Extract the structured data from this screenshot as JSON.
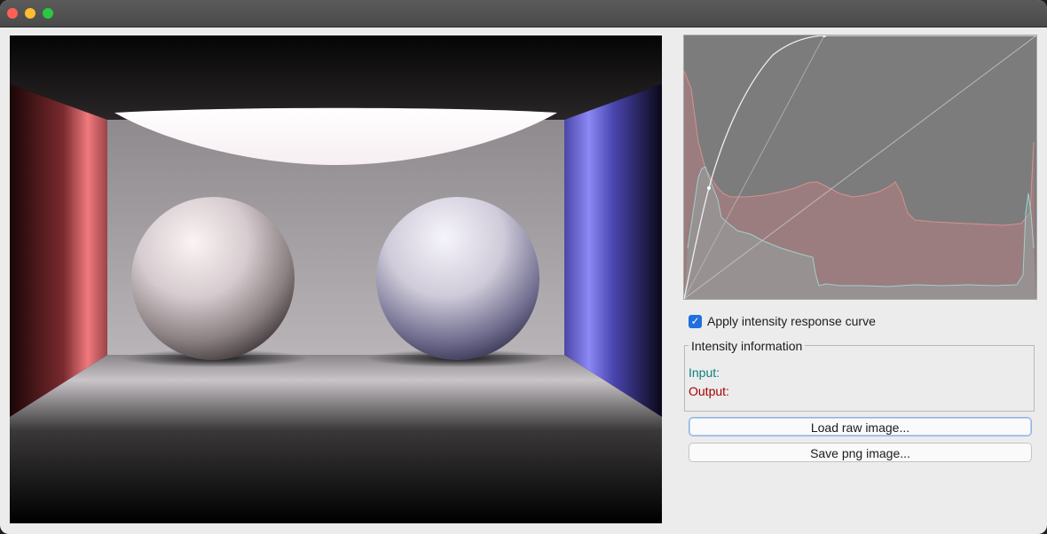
{
  "window": {
    "title": ""
  },
  "render_view": {
    "description_icon": "rendered-scene-image"
  },
  "response_curve": {
    "icon": "intensity-response-curve-graph"
  },
  "controls": {
    "apply_curve_label": "Apply intensity response curve",
    "apply_curve_checked": true,
    "checkmark_glyph": "✓"
  },
  "intensity_info": {
    "legend": "Intensity information",
    "input_label": "Input:",
    "output_label": "Output:"
  },
  "buttons": {
    "load_label": "Load raw image...",
    "save_label": "Save png image..."
  },
  "colors": {
    "input_color": "#0f7d7d",
    "output_color": "#a40000",
    "checkbox_accent": "#1f6fe0"
  }
}
